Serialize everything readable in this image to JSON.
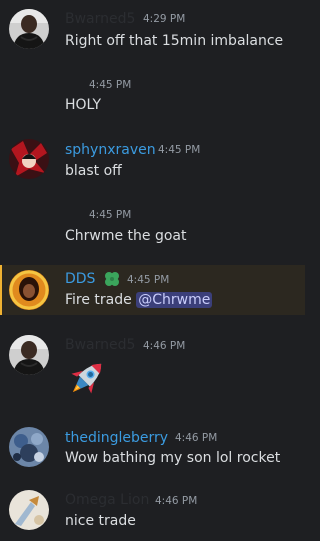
{
  "colors": {
    "background": "#1e1f22",
    "text": "#dbdee1",
    "muted": "#949ba4",
    "user_dark": "#2b2d31",
    "user_blue": "#3b9be0",
    "mention_bg": "#3b3f7a",
    "highlight_bg": "#2c2820"
  },
  "messages": [
    {
      "author": "Bwarned5",
      "time": "4:29 PM",
      "text": "Right off that 15min imbalance",
      "avatar_icon": "user-avatar-bwarned5"
    },
    {
      "time": "4:45 PM",
      "text": "HOLY"
    },
    {
      "author": "sphynxraven",
      "time": "4:45 PM",
      "text": "blast off",
      "avatar_icon": "user-avatar-sphynxraven"
    },
    {
      "time": "4:45 PM",
      "text": "Chrwme the goat"
    },
    {
      "author": "DDS",
      "time": "4:45 PM",
      "text_prefix": "Fire trade ",
      "mention": "@Chrwme",
      "avatar_icon": "user-avatar-dds",
      "badge_icon": "clover-badge-icon"
    },
    {
      "author": "Bwarned5",
      "time": "4:46 PM",
      "emoji": "🚀",
      "avatar_icon": "user-avatar-bwarned5"
    },
    {
      "author": "thedingleberry",
      "time": "4:46 PM",
      "text": "Wow bathing my son lol rocket",
      "avatar_icon": "user-avatar-thedingleberry"
    },
    {
      "author": "Omega Lion",
      "time": "4:46 PM",
      "text": "nice trade",
      "avatar_icon": "user-avatar-omega-lion"
    }
  ]
}
